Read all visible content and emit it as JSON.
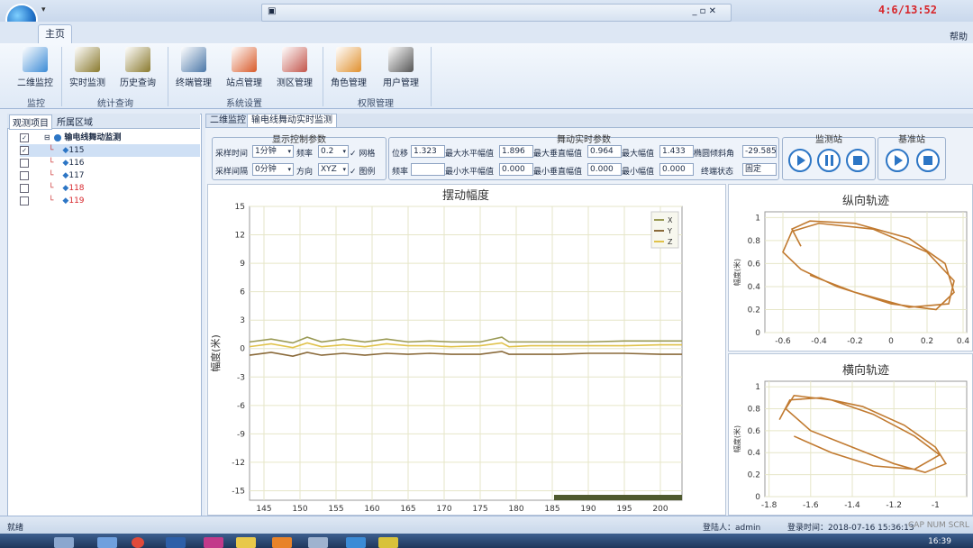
{
  "window": {
    "quick_access": "▾",
    "clock": "4:6/13:52",
    "help": "帮助"
  },
  "ribbon": {
    "tab": "主页",
    "buttons": [
      {
        "label": "二维监控",
        "icon": "map-icon",
        "color": "#3b8bd6"
      },
      {
        "label": "实时监测",
        "icon": "tower-icon",
        "color": "#8a7a2e"
      },
      {
        "label": "历史查询",
        "icon": "tower-icon",
        "color": "#8a7a2e"
      },
      {
        "label": "终端管理",
        "icon": "monitor-icon",
        "color": "#4a77a8"
      },
      {
        "label": "站点管理",
        "icon": "home-icon",
        "color": "#d85a2a"
      },
      {
        "label": "测区管理",
        "icon": "area-icon",
        "color": "#c2544a"
      },
      {
        "label": "角色管理",
        "icon": "user-icon",
        "color": "#e0902e"
      },
      {
        "label": "用户管理",
        "icon": "user-icon",
        "color": "#555555"
      }
    ],
    "groups": [
      "监控",
      "统计查询",
      "系统设置",
      "权限管理"
    ]
  },
  "left": {
    "tabs": [
      "观测项目",
      "所属区域"
    ],
    "root": "输电线舞动监测",
    "items": [
      {
        "id": "115",
        "checked": true,
        "color": "#1b2a44"
      },
      {
        "id": "116",
        "checked": false,
        "color": "#1b2a44"
      },
      {
        "id": "117",
        "checked": false,
        "color": "#1b2a44"
      },
      {
        "id": "118",
        "checked": false,
        "color": "#d7262b"
      },
      {
        "id": "119",
        "checked": false,
        "color": "#d7262b"
      }
    ]
  },
  "main": {
    "tabs": [
      "二维监控",
      "输电线舞动实时监测"
    ],
    "display": {
      "title": "显示控制参数",
      "sample_time_label": "采样时间",
      "sample_time": "1分钟",
      "freq_label": "频率",
      "freq": "0.2",
      "grid_label": "网格",
      "sample_interval_label": "采样间隔",
      "sample_interval": "0分钟",
      "direction_label": "方向",
      "direction": "XYZ",
      "legend_label": "图例"
    },
    "realtime": {
      "title": "舞动实时参数",
      "disp_label": "位移",
      "disp": "1.323",
      "max_h_amp_label": "最大水平幅值",
      "max_h_amp": "1.896",
      "max_v_amp_label": "最大垂直幅值",
      "max_v_amp": "0.964",
      "max_amp_label": "最大幅值",
      "max_amp": "1.433",
      "ellipse_label": "椭圆倾斜角",
      "ellipse": "-29.585",
      "freq_label": "频率",
      "freq": "",
      "min_h_amp_label": "最小水平幅值",
      "min_h_amp": "0.000",
      "min_v_amp_label": "最小垂直幅值",
      "min_v_amp": "0.000",
      "min_amp_label": "最小幅值",
      "min_amp": "0.000",
      "terminal_label": "终端状态",
      "terminal": "固定"
    },
    "station_title": "监测站",
    "base_title": "基准站"
  },
  "chart_data": [
    {
      "type": "line",
      "title": "摆动幅度",
      "ylabel": "幅度(米)",
      "xlim": [
        143,
        203
      ],
      "ylim": [
        -16,
        15
      ],
      "xticks": [
        145,
        150,
        155,
        160,
        165,
        170,
        175,
        180,
        185,
        190,
        195,
        200
      ],
      "yticks": [
        15,
        12,
        9,
        6,
        3,
        0,
        -3,
        -6,
        -9,
        -12,
        -15
      ],
      "grid": true,
      "legend": "top-right",
      "series": [
        {
          "name": "X",
          "color": "#9a9a55",
          "x": [
            143,
            146,
            149,
            151,
            153,
            156,
            159,
            162,
            165,
            168,
            171,
            175,
            178,
            179,
            182,
            186,
            190,
            195,
            200,
            203
          ],
          "y": [
            0.7,
            1.0,
            0.6,
            1.2,
            0.7,
            1.0,
            0.7,
            1.0,
            0.7,
            0.8,
            0.7,
            0.7,
            1.2,
            0.7,
            0.7,
            0.7,
            0.7,
            0.8,
            0.8,
            0.8
          ]
        },
        {
          "name": "Y",
          "color": "#8a6a3a",
          "x": [
            143,
            146,
            149,
            151,
            153,
            156,
            159,
            162,
            165,
            168,
            171,
            175,
            178,
            179,
            182,
            186,
            190,
            195,
            200,
            203
          ],
          "y": [
            -0.7,
            -0.4,
            -0.8,
            -0.4,
            -0.7,
            -0.5,
            -0.7,
            -0.5,
            -0.6,
            -0.5,
            -0.6,
            -0.6,
            -0.3,
            -0.6,
            -0.6,
            -0.6,
            -0.5,
            -0.5,
            -0.6,
            -0.6
          ]
        },
        {
          "name": "Z",
          "color": "#e0c24a",
          "x": [
            143,
            146,
            149,
            151,
            153,
            156,
            159,
            162,
            165,
            168,
            171,
            175,
            178,
            179,
            182,
            186,
            190,
            195,
            200,
            203
          ],
          "y": [
            0.2,
            0.5,
            0.1,
            0.6,
            0.2,
            0.4,
            0.2,
            0.5,
            0.3,
            0.3,
            0.2,
            0.3,
            0.6,
            0.2,
            0.3,
            0.3,
            0.3,
            0.3,
            0.4,
            0.4
          ]
        }
      ]
    },
    {
      "type": "line",
      "title": "纵向轨迹",
      "ylabel": "幅度(米)",
      "xlim": [
        -0.7,
        0.42
      ],
      "ylim": [
        0,
        1.05
      ],
      "xticks": [
        -0.6,
        -0.4,
        -0.2,
        0,
        0.2,
        0.4
      ],
      "yticks": [
        1,
        0.8,
        0.6,
        0.4,
        0.2,
        0
      ],
      "grid": true,
      "series": [
        {
          "color": "#c17a30",
          "x": [
            -0.5,
            -0.55,
            -0.45,
            -0.2,
            0.1,
            0.3,
            0.35,
            0.25,
            0.0,
            -0.3,
            -0.5,
            -0.6,
            -0.55,
            -0.4,
            -0.1,
            0.2,
            0.35,
            0.32,
            0.1,
            -0.2,
            -0.45
          ],
          "y": [
            0.75,
            0.9,
            0.97,
            0.95,
            0.82,
            0.6,
            0.35,
            0.2,
            0.25,
            0.4,
            0.55,
            0.7,
            0.88,
            0.95,
            0.9,
            0.7,
            0.45,
            0.25,
            0.22,
            0.35,
            0.5
          ]
        }
      ]
    },
    {
      "type": "line",
      "title": "横向轨迹",
      "ylabel": "幅度(米)",
      "xlim": [
        -1.82,
        -0.85
      ],
      "ylim": [
        0,
        1.05
      ],
      "xticks": [
        -1.8,
        -1.6,
        -1.4,
        -1.2,
        -1
      ],
      "yticks": [
        1,
        0.8,
        0.6,
        0.4,
        0.2,
        0
      ],
      "grid": true,
      "series": [
        {
          "color": "#c17a30",
          "x": [
            -1.75,
            -1.7,
            -1.55,
            -1.35,
            -1.15,
            -1.0,
            -0.95,
            -1.05,
            -1.2,
            -1.4,
            -1.6,
            -1.72,
            -1.68,
            -1.5,
            -1.3,
            -1.1,
            -0.98,
            -1.1,
            -1.3,
            -1.5,
            -1.68
          ],
          "y": [
            0.7,
            0.88,
            0.9,
            0.82,
            0.65,
            0.45,
            0.3,
            0.22,
            0.3,
            0.45,
            0.6,
            0.8,
            0.92,
            0.88,
            0.75,
            0.55,
            0.38,
            0.25,
            0.28,
            0.4,
            0.55
          ]
        }
      ]
    }
  ],
  "status": {
    "ready": "就绪",
    "login_user": "登陆人：admin",
    "login_time": "登录时间：2018-07-16 15:36:13",
    "indicators": "CAP  NUM  SCRL"
  },
  "taskbar": {
    "time": "16:39"
  }
}
